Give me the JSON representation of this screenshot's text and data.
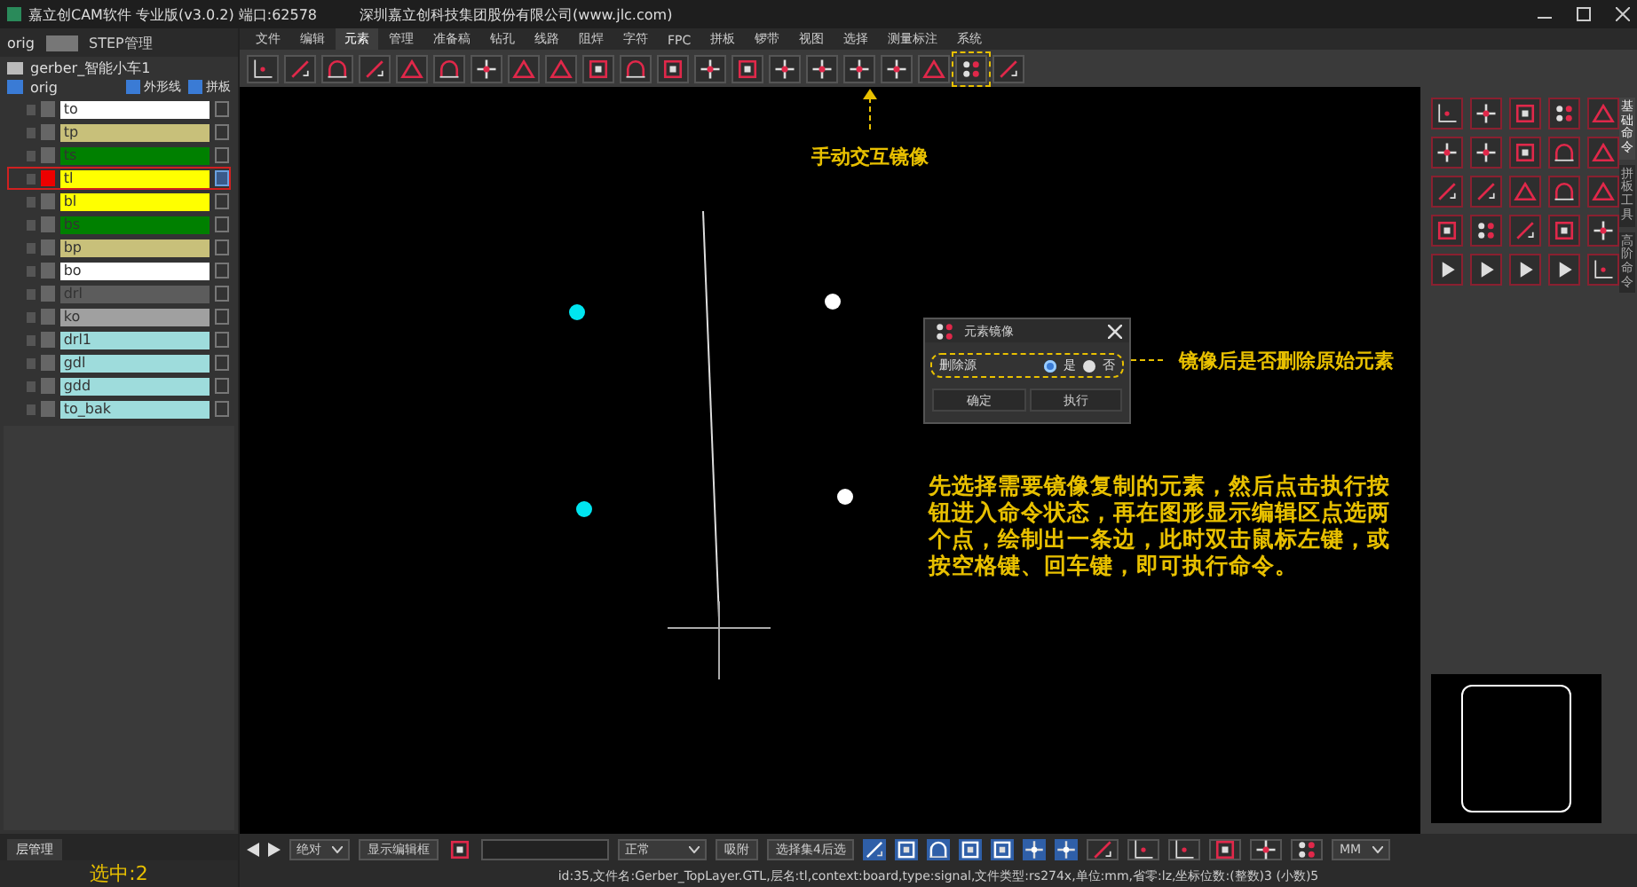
{
  "title_bar": {
    "app_title": "嘉立创CAM软件 专业版(v3.0.2) 端口:62578",
    "company": "深圳嘉立创科技集团股份有限公司(www.jlc.com)"
  },
  "left_panel": {
    "step_field": "orig",
    "step_button": "STEP管理",
    "job": "gerber_智能小车1",
    "step": "orig",
    "options": [
      {
        "label": "外形线",
        "checked": true
      },
      {
        "label": "拼板",
        "checked": true
      }
    ],
    "layers": [
      {
        "name": "to",
        "color": "#ffffff",
        "selected": false
      },
      {
        "name": "tp",
        "color": "#c8c07a",
        "selected": false
      },
      {
        "name": "ts",
        "color": "#008000",
        "selected": false
      },
      {
        "name": "tl",
        "color": "#ffff00",
        "selected": true
      },
      {
        "name": "bl",
        "color": "#ffff00",
        "selected": false
      },
      {
        "name": "bs",
        "color": "#008000",
        "selected": false
      },
      {
        "name": "bp",
        "color": "#c8c07a",
        "selected": false
      },
      {
        "name": "bo",
        "color": "#ffffff",
        "selected": false
      },
      {
        "name": "drl",
        "color": "#5c5c5c",
        "selected": false
      },
      {
        "name": "ko",
        "color": "#a0a0a0",
        "selected": false
      },
      {
        "name": "drl1",
        "color": "#9edcdc",
        "selected": false
      },
      {
        "name": "gdl",
        "color": "#9edcdc",
        "selected": false
      },
      {
        "name": "gdd",
        "color": "#9edcdc",
        "selected": false
      },
      {
        "name": "to_bak",
        "color": "#9edcdc",
        "selected": false
      }
    ],
    "tab": "层管理",
    "selection_count": "选中:2"
  },
  "menu_tabs": [
    {
      "label": "文件",
      "selected": false
    },
    {
      "label": "编辑",
      "selected": false
    },
    {
      "label": "元素",
      "selected": true
    },
    {
      "label": "管理",
      "selected": false
    },
    {
      "label": "准备稿",
      "selected": false
    },
    {
      "label": "钻孔",
      "selected": false
    },
    {
      "label": "线路",
      "selected": false
    },
    {
      "label": "阻焊",
      "selected": false
    },
    {
      "label": "字符",
      "selected": false
    },
    {
      "label": "FPC",
      "selected": false
    },
    {
      "label": "拼板",
      "selected": false
    },
    {
      "label": "锣带",
      "selected": false
    },
    {
      "label": "视图",
      "selected": false
    },
    {
      "label": "选择",
      "selected": false
    },
    {
      "label": "测量标注",
      "selected": false
    },
    {
      "label": "系统",
      "selected": false
    }
  ],
  "canvas": {
    "toolbar_callout": "手动交互镜像",
    "dialog_callout": "镜像后是否删除原始元素",
    "instructions": "先选择需要镜像复制的元素，然后点击执行按钮进入命令状态，再在图形显示编辑区点选两个点，绘制出一条边，此时双击鼠标左键，或按空格键、回车键，即可执行命令。"
  },
  "dialog": {
    "title": "元素镜像",
    "option_label": "删除源",
    "options": [
      {
        "label": "是",
        "selected": true
      },
      {
        "label": "否",
        "selected": false
      }
    ],
    "buttons": [
      "确定",
      "执行"
    ]
  },
  "right_panel": {
    "tabs": [
      {
        "label": "基础命令",
        "selected": true
      },
      {
        "label": "拼板工具",
        "selected": false
      },
      {
        "label": "高阶命令",
        "selected": false
      }
    ]
  },
  "bottom_toolbar": {
    "coord_mode": "绝对",
    "edit_box_button": "显示编辑框",
    "mode": "正常",
    "snap_button": "吸附",
    "select_button": "选择集4后选",
    "unit": "MM"
  },
  "status_bar": "id:35,文件名:Gerber_TopLayer.GTL,层名:tl,context:board,type:signal,文件类型:rs274x,单位:mm,省零:lz,坐标位数:(整数)3 (小数)5"
}
